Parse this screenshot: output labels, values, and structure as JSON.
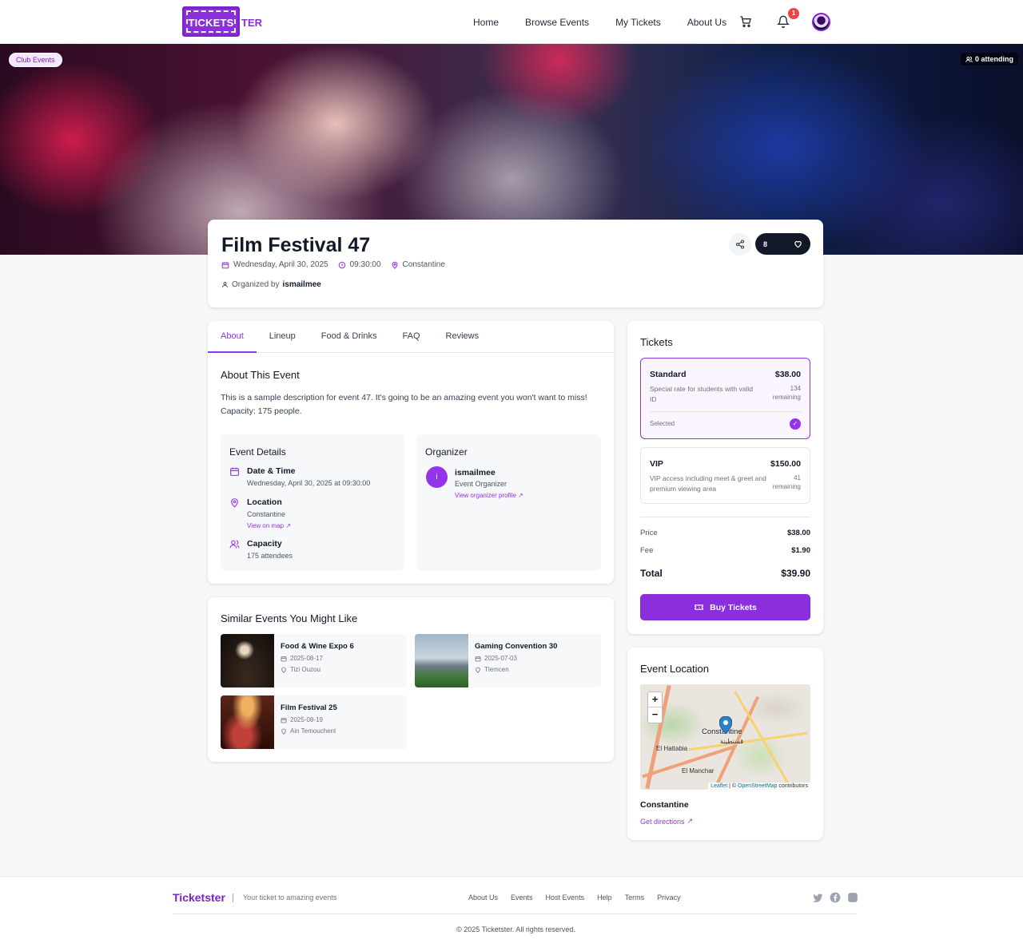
{
  "brand": {
    "logo_text": "TICKETS",
    "logo_tail": "TER"
  },
  "nav": {
    "links": [
      "Home",
      "Browse Events",
      "My Tickets",
      "About Us"
    ],
    "notifications": "1"
  },
  "hero": {
    "category_badge": "Club Events",
    "attending": "0 attending"
  },
  "event": {
    "title": "Film Festival 47",
    "date": "Wednesday, April 30, 2025",
    "time": "09:30:00",
    "location": "Constantine",
    "organized_prefix": "Organized by",
    "organizer": "ismailmee",
    "likes": "8"
  },
  "tabs": [
    "About",
    "Lineup",
    "Food & Drinks",
    "FAQ",
    "Reviews"
  ],
  "about": {
    "title": "About This Event",
    "description": "This is a sample description for event 47. It's going to be an amazing event you won't want to miss! Capacity: 175 people."
  },
  "details": {
    "title": "Event Details",
    "date_label": "Date & Time",
    "date_value": "Wednesday, April 30, 2025 at 09:30:00",
    "location_label": "Location",
    "location_value": "Constantine",
    "map_link": "View on map",
    "capacity_label": "Capacity",
    "capacity_value": "175 attendees"
  },
  "organizer_box": {
    "title": "Organizer",
    "initial": "i",
    "name": "ismailmee",
    "role": "Event Organizer",
    "link": "View organizer profile"
  },
  "similar": {
    "title": "Similar Events You Might Like",
    "items": [
      {
        "name": "Food & Wine Expo 6",
        "date": "2025-08-17",
        "location": "Tizi Ouzou"
      },
      {
        "name": "Gaming Convention 30",
        "date": "2025-07-03",
        "location": "Tlemcen"
      },
      {
        "name": "Film Festival 25",
        "date": "2025-08-19",
        "location": "Ain Temouchent"
      }
    ]
  },
  "tickets": {
    "title": "Tickets",
    "options": [
      {
        "name": "Standard",
        "price": "$38.00",
        "description": "Special rate for students with valid ID",
        "remaining_count": "134",
        "remaining_label": "remaining",
        "selected_label": "Selected"
      },
      {
        "name": "VIP",
        "price": "$150.00",
        "description": "VIP access including meet & greet and premium viewing area",
        "remaining_count": "41",
        "remaining_label": "remaining"
      }
    ],
    "summary": {
      "price_label": "Price",
      "price": "$38.00",
      "fee_label": "Fee",
      "fee": "$1.90",
      "total_label": "Total",
      "total": "$39.90"
    },
    "buy_label": "Buy Tickets"
  },
  "location_card": {
    "title": "Event Location",
    "map": {
      "zoom_in": "+",
      "zoom_out": "−",
      "city_label": "Constantine",
      "arabic_label": "قسنطينة",
      "label_hattabia": "El Hattabia",
      "label_manchar": "El Manchar",
      "attribution_leaflet": "Leaflet",
      "attribution_sep": "| ©",
      "attribution_osm": "OpenStreetMap",
      "attribution_tail": "contributors"
    },
    "name": "Constantine",
    "directions": "Get directions"
  },
  "footer": {
    "brand": "Ticketster",
    "tagline": "Your ticket to amazing events",
    "links": [
      "About Us",
      "Events",
      "Host Events",
      "Help",
      "Terms",
      "Privacy"
    ],
    "copyright": "© 2025 Ticketster. All rights reserved."
  },
  "colors": {
    "accent": "#9333ea",
    "accent_dark": "#7e22ce",
    "button": "#8b2fdc",
    "badge": "#ef4444"
  }
}
